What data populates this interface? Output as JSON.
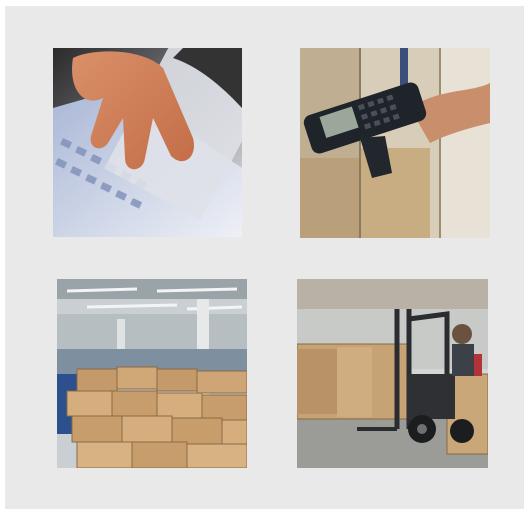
{
  "gallery": {
    "background": "#e9e9e9",
    "tiles": [
      {
        "id": "keyboard-typing-photo",
        "subject": "hand-typing-on-keyboard-icon"
      },
      {
        "id": "barcode-scanner-photo",
        "subject": "handheld-barcode-scanner-icon"
      },
      {
        "id": "warehouse-boxes-photo",
        "subject": "stacked-cardboard-boxes-icon"
      },
      {
        "id": "forklift-photo",
        "subject": "forklift-moving-boxes-icon"
      }
    ]
  }
}
